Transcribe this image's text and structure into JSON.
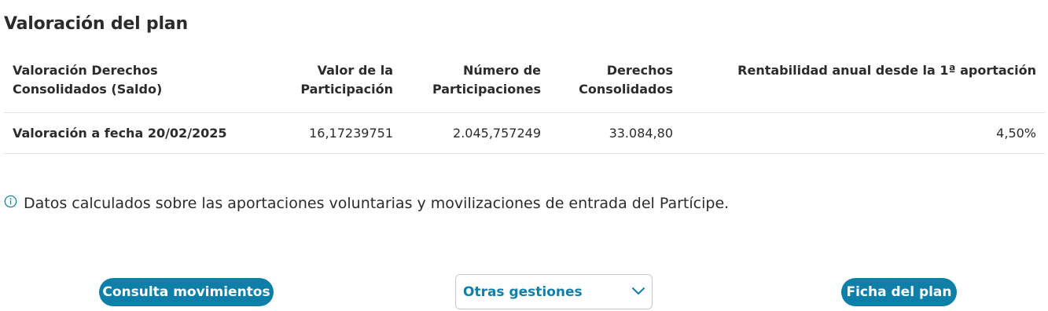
{
  "section": {
    "title": "Valoración del plan"
  },
  "table": {
    "headers": [
      "Valoración Derechos\n Consolidados (Saldo)",
      "Valor de la\nParticipación",
      "Número de\nParticipaciones",
      "Derechos\nConsolidados",
      "Rentabilidad anual desde la 1ª aportación"
    ],
    "rows": [
      {
        "label": "Valoración a fecha 20/02/2025",
        "valor_participacion": "16,17239751",
        "numero_participaciones": "2.045,757249",
        "derechos_consolidados": "33.084,80",
        "rentabilidad": "4,50%"
      }
    ]
  },
  "info": {
    "icon": "info-icon",
    "text": "Datos calculados sobre las aportaciones voluntarias y movilizaciones de entrada del Partícipe."
  },
  "actions": {
    "consulta_movimientos": "Consulta movimientos",
    "otras_gestiones": "Otras gestiones",
    "ficha_plan": "Ficha del plan"
  },
  "colors": {
    "accent": "#0d7fa8",
    "text": "#2b2b2b",
    "divider": "#e2e2e2"
  }
}
